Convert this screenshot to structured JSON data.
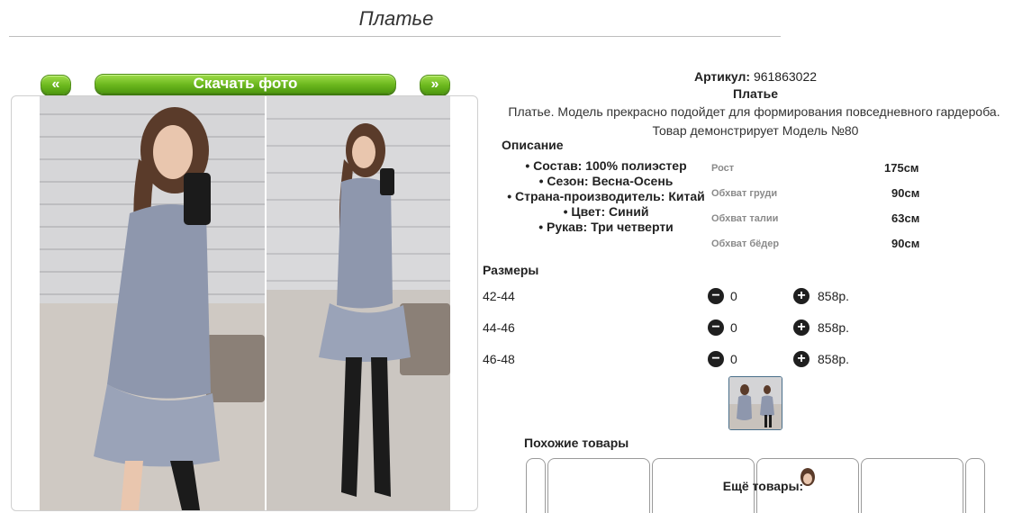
{
  "page": {
    "title": "Платье"
  },
  "gallery": {
    "prev_label": "«",
    "download_label": "Скачать фото",
    "next_label": "»"
  },
  "product": {
    "article_label": "Артикул:",
    "article_value": "961863022",
    "name": "Платье",
    "description": "Платье. Модель прекрасно подойдет для формирования повседневного гардероба.",
    "model_note": "Товар демонстрирует Модель №80"
  },
  "description_section": {
    "heading": "Описание",
    "specs": [
      "Состав: 100% полиэстер",
      "Сезон: Весна-Осень",
      "Страна-производитель: Китай",
      "Цвет: Синий",
      "Рукав: Три четверти"
    ]
  },
  "measurements": [
    {
      "label": "Рост",
      "value": "175см"
    },
    {
      "label": "Обхват груди",
      "value": "90см"
    },
    {
      "label": "Обхват талии",
      "value": "63см"
    },
    {
      "label": "Обхват бёдер",
      "value": "90см"
    }
  ],
  "sizes": {
    "heading": "Размеры",
    "rows": [
      {
        "size": "42-44",
        "qty": "0",
        "price": "858р."
      },
      {
        "size": "44-46",
        "qty": "0",
        "price": "858р."
      },
      {
        "size": "46-48",
        "qty": "0",
        "price": "858р."
      }
    ],
    "minus_symbol": "−",
    "plus_symbol": "+"
  },
  "similar": {
    "heading": "Похожие товары",
    "more_heading": "Ещё товары:"
  },
  "colors": {
    "button_green": "#6cb81e",
    "dress": "#8e97ad",
    "wall": "#d9d9d9"
  }
}
